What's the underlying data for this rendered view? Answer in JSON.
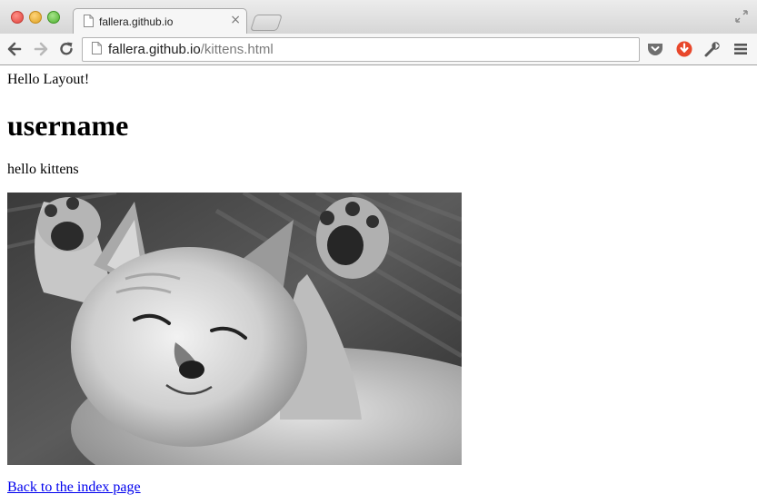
{
  "browser": {
    "tab": {
      "title": "fallera.github.io",
      "close_glyph": "×"
    },
    "omnibox": {
      "host": "fallera.github.io",
      "path": "/kittens.html"
    },
    "icons": {
      "back": "back-arrow-icon",
      "forward": "forward-arrow-icon",
      "reload": "reload-icon",
      "page": "page-icon",
      "pocket": "pocket-icon",
      "download": "download-icon",
      "wrench": "wrench-icon",
      "menu": "hamburger-menu-icon",
      "fullscreen": "fullscreen-icon"
    }
  },
  "page": {
    "intro": "Hello Layout!",
    "heading": "username",
    "tagline": "hello kittens",
    "image": {
      "subject": "sleeping kitten",
      "tone": "grayscale"
    },
    "back_link": "Back to the index page"
  },
  "colors": {
    "link": "#0000ee",
    "pocket": "#6f6f6f",
    "download": "#e8472b"
  }
}
